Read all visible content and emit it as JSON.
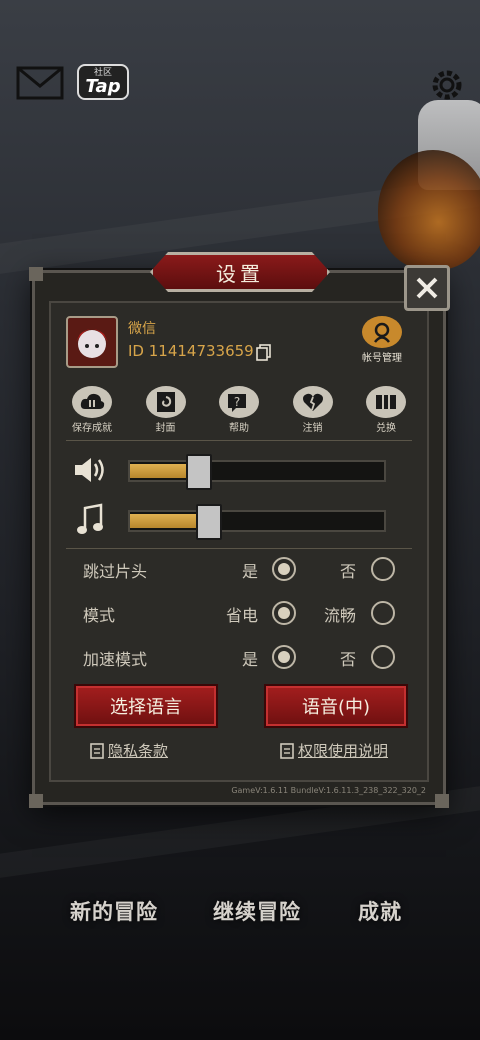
{
  "top_bar": {
    "mail_icon": "envelope-icon",
    "tap": {
      "sub": "社区",
      "main": "Tap"
    },
    "settings_icon": "gear-icon"
  },
  "settings": {
    "title": "设置",
    "close_icon": "close-icon",
    "profile": {
      "name": "微信",
      "id": "ID 11414733659",
      "account_label": "帐号管理"
    },
    "actions": [
      {
        "label": "保存成就",
        "icon": "cloud-sync-icon"
      },
      {
        "label": "封面",
        "icon": "swirl-icon"
      },
      {
        "label": "帮助",
        "icon": "help-icon"
      },
      {
        "label": "注销",
        "icon": "broken-heart-icon"
      },
      {
        "label": "兑换",
        "icon": "gift-box-icon"
      }
    ],
    "volume": {
      "sound_fill": 0.27,
      "music_fill": 0.31
    },
    "options": [
      {
        "label": "跳过片头",
        "a": "是",
        "b": "否",
        "selected": "a"
      },
      {
        "label": "模式",
        "a": "省电",
        "b": "流畅",
        "selected": "a"
      },
      {
        "label": "加速模式",
        "a": "是",
        "b": "否",
        "selected": "a"
      }
    ],
    "language_button": "选择语言",
    "voice_button": "语音(中)",
    "privacy_link": "隐私条款",
    "permission_link": "权限使用说明",
    "version": "GameV:1.6.11 BundleV:1.6.11.3_238_322_320_2"
  },
  "main_menu": {
    "new_adventure": "新的冒险",
    "continue_adventure": "继续冒险",
    "achievements": "成就"
  },
  "colors": {
    "accent_red": "#8a1a1a",
    "gold": "#d8a54a",
    "panel": "#2c2b27"
  }
}
